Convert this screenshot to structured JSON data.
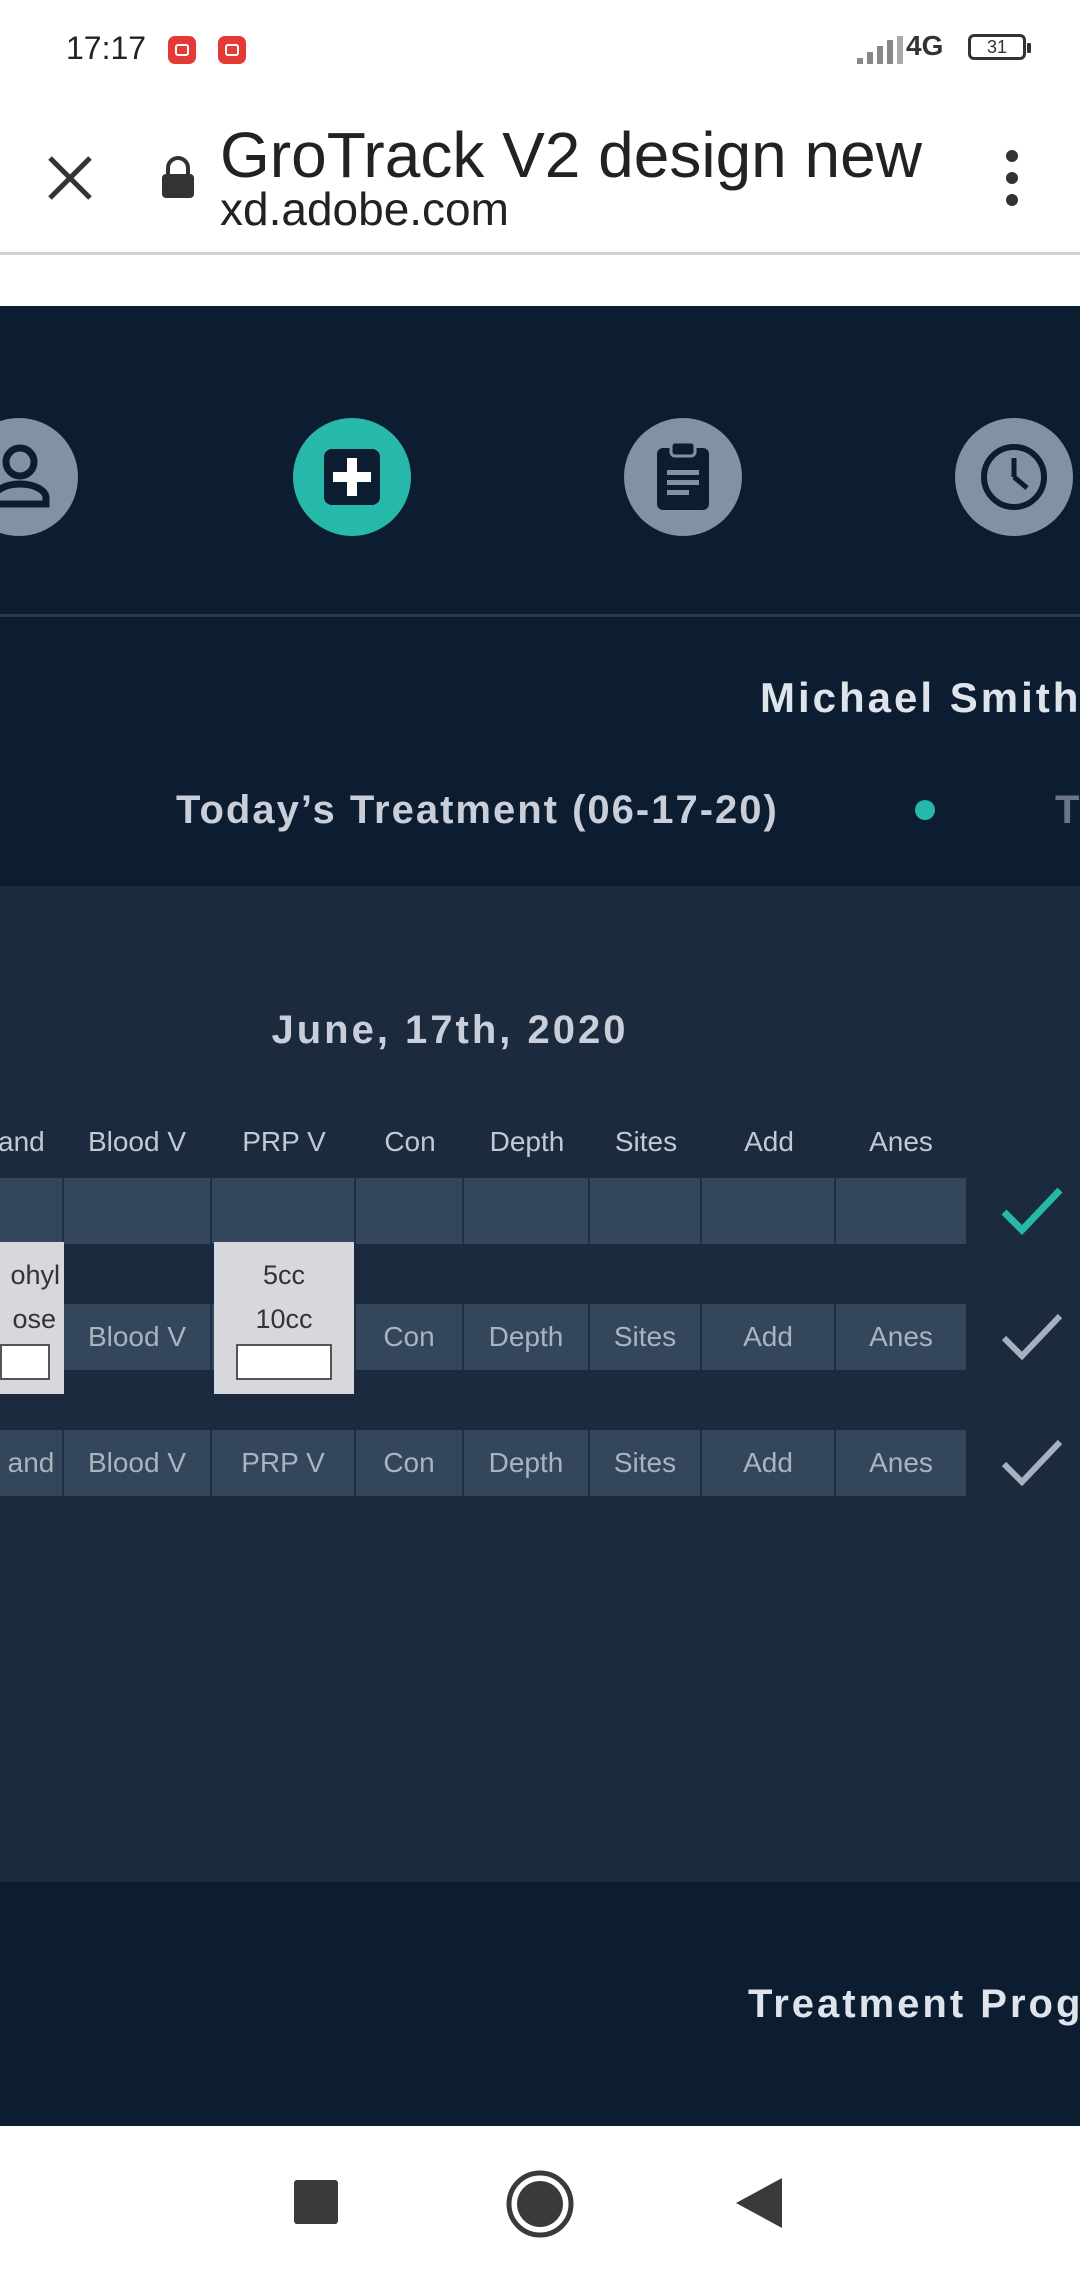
{
  "status_bar": {
    "time": "17:17",
    "network": "4G",
    "battery": "31"
  },
  "browser": {
    "title": "GroTrack V2 design new",
    "url": "xd.adobe.com"
  },
  "app": {
    "nav_icons": [
      "person-icon",
      "medical-plus-icon",
      "clipboard-icon",
      "clock-icon"
    ],
    "active_nav": "medical-plus-icon",
    "patient_name": "Michael Smith",
    "treatment_tab": "Today’s Treatment (06-17-20)",
    "next_tab_initial": "T",
    "date_heading": "June, 17th, 2020",
    "columns": [
      "and",
      "Blood V",
      "PRP V",
      "Con",
      "Depth",
      "Sites",
      "Add",
      "Anes"
    ],
    "rows": [
      {
        "cells": [
          "",
          "",
          "",
          "",
          "",
          "",
          "",
          ""
        ],
        "checked": true
      },
      {
        "cells": [
          "",
          "Blood V",
          "",
          "Con",
          "Depth",
          "Sites",
          "Add",
          "Anes"
        ],
        "checked": false
      },
      {
        "cells": [
          "and",
          "Blood V",
          "PRP V",
          "Con",
          "Depth",
          "Sites",
          "Add",
          "Anes"
        ],
        "checked": false
      }
    ],
    "popup_left": {
      "line1": "ohyl",
      "line2": "ose"
    },
    "popup_prp": {
      "line1": "5cc",
      "line2": "10cc"
    },
    "progress_title": "Treatment Progr",
    "colors": {
      "accent": "#26b8a8",
      "background": "#0c1d31",
      "panel": "#1b2a3d",
      "row": "#33465b"
    }
  }
}
